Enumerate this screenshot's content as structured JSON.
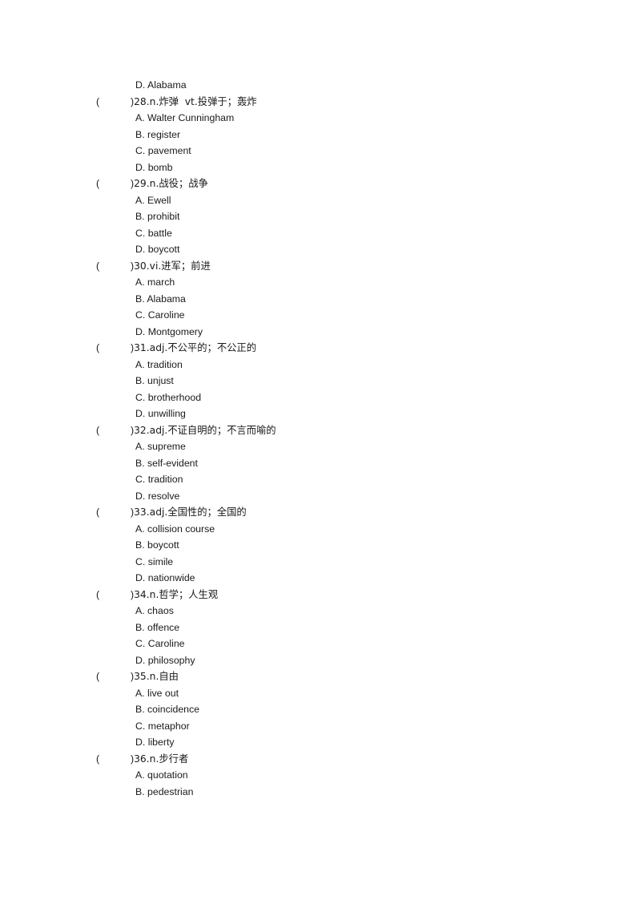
{
  "document": {
    "type": "vocabulary-quiz-worksheet",
    "page_background": "#ffffff",
    "text_color": "#1a1a1a",
    "leading_orphan_option": {
      "label": "D.",
      "text": "Alabama",
      "full": "D. Alabama"
    },
    "questions": [
      {
        "number": "28",
        "marker_open": "(",
        "marker_close": ")",
        "prompt": "28.n.炸弹  vt.投弹于；轰炸",
        "options": [
          {
            "label": "A.",
            "text": "Walter Cunningham",
            "full": "A. Walter Cunningham"
          },
          {
            "label": "B.",
            "text": "register",
            "full": "B. register"
          },
          {
            "label": "C.",
            "text": "pavement",
            "full": "C. pavement"
          },
          {
            "label": "D.",
            "text": "bomb",
            "full": "D. bomb"
          }
        ]
      },
      {
        "number": "29",
        "marker_open": "(",
        "marker_close": ")",
        "prompt": "29.n.战役；战争",
        "options": [
          {
            "label": "A.",
            "text": "Ewell",
            "full": "A. Ewell"
          },
          {
            "label": "B.",
            "text": "prohibit",
            "full": "B. prohibit"
          },
          {
            "label": "C.",
            "text": "battle",
            "full": "C. battle"
          },
          {
            "label": "D.",
            "text": "boycott",
            "full": "D. boycott"
          }
        ]
      },
      {
        "number": "30",
        "marker_open": "(",
        "marker_close": ")",
        "prompt": "30.vi.进军；前进",
        "options": [
          {
            "label": "A.",
            "text": "march",
            "full": "A. march"
          },
          {
            "label": "B.",
            "text": "Alabama",
            "full": "B. Alabama"
          },
          {
            "label": "C.",
            "text": "Caroline",
            "full": "C. Caroline"
          },
          {
            "label": "D.",
            "text": "Montgomery",
            "full": "D. Montgomery"
          }
        ]
      },
      {
        "number": "31",
        "marker_open": "(",
        "marker_close": ")",
        "prompt": "31.adj.不公平的；不公正的",
        "options": [
          {
            "label": "A.",
            "text": "tradition",
            "full": "A. tradition"
          },
          {
            "label": "B.",
            "text": "unjust",
            "full": "B. unjust"
          },
          {
            "label": "C.",
            "text": "brotherhood",
            "full": "C. brotherhood"
          },
          {
            "label": "D.",
            "text": "unwilling",
            "full": "D. unwilling"
          }
        ]
      },
      {
        "number": "32",
        "marker_open": "(",
        "marker_close": ")",
        "prompt": "32.adj.不证自明的；不言而喻的",
        "options": [
          {
            "label": "A.",
            "text": "supreme",
            "full": "A. supreme"
          },
          {
            "label": "B.",
            "text": "self-evident",
            "full": "B. self-evident"
          },
          {
            "label": "C.",
            "text": "tradition",
            "full": "C. tradition"
          },
          {
            "label": "D.",
            "text": "resolve",
            "full": "D. resolve"
          }
        ]
      },
      {
        "number": "33",
        "marker_open": "(",
        "marker_close": ")",
        "prompt": "33.adj.全国性的；全国的",
        "options": [
          {
            "label": "A.",
            "text": "collision course",
            "full": "A. collision course"
          },
          {
            "label": "B.",
            "text": "boycott",
            "full": "B. boycott"
          },
          {
            "label": "C.",
            "text": "simile",
            "full": "C. simile"
          },
          {
            "label": "D.",
            "text": "nationwide",
            "full": "D. nationwide"
          }
        ]
      },
      {
        "number": "34",
        "marker_open": "(",
        "marker_close": ")",
        "prompt": "34.n.哲学；人生观",
        "options": [
          {
            "label": "A.",
            "text": "chaos",
            "full": "A. chaos"
          },
          {
            "label": "B.",
            "text": "offence",
            "full": "B. offence"
          },
          {
            "label": "C.",
            "text": "Caroline",
            "full": "C. Caroline"
          },
          {
            "label": "D.",
            "text": "philosophy",
            "full": "D. philosophy"
          }
        ]
      },
      {
        "number": "35",
        "marker_open": "(",
        "marker_close": ")",
        "prompt": "35.n.自由",
        "options": [
          {
            "label": "A.",
            "text": "live out",
            "full": "A. live out"
          },
          {
            "label": "B.",
            "text": "coincidence",
            "full": "B. coincidence"
          },
          {
            "label": "C.",
            "text": "metaphor",
            "full": "C. metaphor"
          },
          {
            "label": "D.",
            "text": "liberty",
            "full": "D. liberty"
          }
        ]
      },
      {
        "number": "36",
        "marker_open": "(",
        "marker_close": ")",
        "prompt": "36.n.步行者",
        "options": [
          {
            "label": "A.",
            "text": "quotation",
            "full": "A. quotation"
          },
          {
            "label": "B.",
            "text": "pedestrian",
            "full": "B. pedestrian"
          }
        ]
      }
    ]
  }
}
